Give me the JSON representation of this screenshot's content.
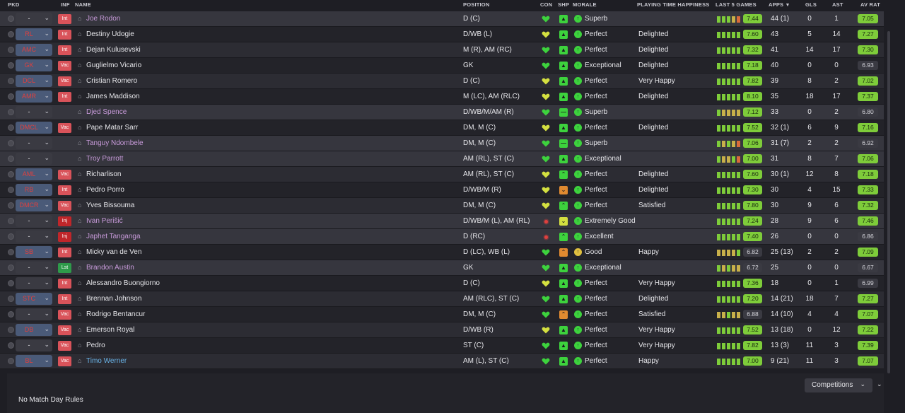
{
  "headers": {
    "pkd": "PKD",
    "inf": "INF",
    "name": "NAME",
    "position": "POSITION",
    "con": "CON",
    "shp": "SHP",
    "morale": "MORALE",
    "pth": "PLAYING TIME HAPPINESS",
    "last5": "LAST 5 GAMES",
    "apps": "APPS",
    "gls": "GLS",
    "ast": "AST",
    "avrat": "AV RAT"
  },
  "players": [
    {
      "pkd": "-",
      "sel": false,
      "inf": "Int",
      "name": "Joe Rodon",
      "name_style": "pink",
      "position": "D (C)",
      "con": "green",
      "shp": "up",
      "morale": "Superb",
      "pth": "",
      "last5": [
        "#7ecc3a",
        "#7ecc3a",
        "#7ecc3a",
        "#c8b04a",
        "#d96b3a"
      ],
      "l5": "7.44",
      "l5_green": true,
      "apps": "44 (1)",
      "gls": "0",
      "ast": "1",
      "avr": "7.05",
      "avr_green": true,
      "loan": true
    },
    {
      "pkd": "RL",
      "sel": true,
      "inf": "Int",
      "name": "Destiny Udogie",
      "name_style": "",
      "position": "D/WB (L)",
      "con": "yellow",
      "shp": "up",
      "morale": "Perfect",
      "pth": "Delighted",
      "last5": [
        "#7ecc3a",
        "#7ecc3a",
        "#7ecc3a",
        "#7ecc3a",
        "#7ecc3a"
      ],
      "l5": "7.60",
      "l5_green": true,
      "apps": "43",
      "gls": "5",
      "ast": "14",
      "avr": "7.27",
      "avr_green": true,
      "loan": false
    },
    {
      "pkd": "AMC",
      "sel": true,
      "inf": "Int",
      "name": "Dejan Kulusevski",
      "name_style": "",
      "position": "M (R), AM (RC)",
      "con": "green",
      "shp": "up",
      "morale": "Perfect",
      "pth": "Delighted",
      "last5": [
        "#7ecc3a",
        "#7ecc3a",
        "#7ecc3a",
        "#7ecc3a",
        "#7ecc3a"
      ],
      "l5": "7.32",
      "l5_green": true,
      "apps": "41",
      "gls": "14",
      "ast": "17",
      "avr": "7.30",
      "avr_green": true,
      "loan": false
    },
    {
      "pkd": "GK",
      "sel": true,
      "inf": "Vac",
      "name": "Guglielmo Vicario",
      "name_style": "",
      "position": "GK",
      "con": "green",
      "shp": "up",
      "morale": "Exceptional",
      "pth": "Delighted",
      "last5": [
        "#7ecc3a",
        "#7ecc3a",
        "#7ecc3a",
        "#7ecc3a",
        "#7ecc3a"
      ],
      "l5": "7.18",
      "l5_green": true,
      "apps": "40",
      "gls": "0",
      "ast": "0",
      "avr": "6.93",
      "avr_green": false,
      "loan": false
    },
    {
      "pkd": "DCL",
      "sel": true,
      "inf": "Vac",
      "name": "Cristian Romero",
      "name_style": "",
      "position": "D (C)",
      "con": "yellow",
      "shp": "up",
      "morale": "Perfect",
      "pth": "Very Happy",
      "last5": [
        "#7ecc3a",
        "#7ecc3a",
        "#7ecc3a",
        "#7ecc3a",
        "#7ecc3a"
      ],
      "l5": "7.82",
      "l5_green": true,
      "apps": "39",
      "gls": "8",
      "ast": "2",
      "avr": "7.02",
      "avr_green": true,
      "loan": false
    },
    {
      "pkd": "AMR",
      "sel": true,
      "inf": "Int",
      "name": "James Maddison",
      "name_style": "",
      "position": "M (LC), AM (RLC)",
      "con": "yellow",
      "shp": "up",
      "morale": "Perfect",
      "pth": "Delighted",
      "last5": [
        "#7ecc3a",
        "#7ecc3a",
        "#7ecc3a",
        "#7ecc3a",
        "#7ecc3a"
      ],
      "l5": "8.10",
      "l5_green": true,
      "apps": "35",
      "gls": "18",
      "ast": "17",
      "avr": "7.37",
      "avr_green": true,
      "loan": false
    },
    {
      "pkd": "-",
      "sel": false,
      "inf": "",
      "name": "Djed Spence",
      "name_style": "pink",
      "position": "D/WB/M/AM (R)",
      "con": "green",
      "shp": "flat",
      "morale": "Superb",
      "pth": "",
      "last5": [
        "#7ecc3a",
        "#c8b04a",
        "#c8b04a",
        "#c8b04a",
        "#c8b04a"
      ],
      "l5": "7.12",
      "l5_green": true,
      "apps": "33",
      "gls": "0",
      "ast": "2",
      "avr": "6.80",
      "avr_green": false,
      "loan": true
    },
    {
      "pkd": "DMCL",
      "sel": true,
      "inf": "Vac",
      "name": "Pape Matar Sarr",
      "name_style": "",
      "position": "DM, M (C)",
      "con": "yellow",
      "shp": "up",
      "morale": "Perfect",
      "pth": "Delighted",
      "last5": [
        "#7ecc3a",
        "#7ecc3a",
        "#7ecc3a",
        "#7ecc3a",
        "#7ecc3a"
      ],
      "l5": "7.52",
      "l5_green": true,
      "apps": "32 (1)",
      "gls": "6",
      "ast": "9",
      "avr": "7.16",
      "avr_green": true,
      "loan": false
    },
    {
      "pkd": "-",
      "sel": false,
      "inf": "",
      "name": "Tanguy Ndombele",
      "name_style": "pink",
      "position": "DM, M (C)",
      "con": "green",
      "shp": "flat",
      "morale": "Superb",
      "pth": "",
      "last5": [
        "#7ecc3a",
        "#c8b04a",
        "#7ecc3a",
        "#c8b04a",
        "#d96b3a"
      ],
      "l5": "7.06",
      "l5_green": true,
      "apps": "31 (7)",
      "gls": "2",
      "ast": "2",
      "avr": "6.92",
      "avr_green": false,
      "loan": true
    },
    {
      "pkd": "-",
      "sel": false,
      "inf": "",
      "name": "Troy Parrott",
      "name_style": "pink",
      "position": "AM (RL), ST (C)",
      "con": "green",
      "shp": "up",
      "morale": "Exceptional",
      "pth": "",
      "last5": [
        "#7ecc3a",
        "#c8b04a",
        "#c8b04a",
        "#7ecc3a",
        "#d96b3a"
      ],
      "l5": "7.00",
      "l5_green": true,
      "apps": "31",
      "gls": "8",
      "ast": "7",
      "avr": "7.06",
      "avr_green": true,
      "loan": true
    },
    {
      "pkd": "AML",
      "sel": true,
      "inf": "Vac",
      "name": "Richarlison",
      "name_style": "",
      "position": "AM (RL), ST (C)",
      "con": "yellow",
      "shp": "up2",
      "morale": "Perfect",
      "pth": "Delighted",
      "last5": [
        "#7ecc3a",
        "#7ecc3a",
        "#7ecc3a",
        "#7ecc3a",
        "#7ecc3a"
      ],
      "l5": "7.60",
      "l5_green": true,
      "apps": "30 (1)",
      "gls": "12",
      "ast": "8",
      "avr": "7.18",
      "avr_green": true,
      "loan": false
    },
    {
      "pkd": "RB",
      "sel": true,
      "inf": "Int",
      "name": "Pedro Porro",
      "name_style": "",
      "position": "D/WB/M (R)",
      "con": "yellow",
      "shp": "down",
      "morale": "Perfect",
      "pth": "Delighted",
      "last5": [
        "#7ecc3a",
        "#7ecc3a",
        "#7ecc3a",
        "#7ecc3a",
        "#7ecc3a"
      ],
      "l5": "7.30",
      "l5_green": true,
      "apps": "30",
      "gls": "4",
      "ast": "15",
      "avr": "7.33",
      "avr_green": true,
      "loan": false
    },
    {
      "pkd": "DMCR",
      "sel": true,
      "inf": "Vac",
      "name": "Yves Bissouma",
      "name_style": "",
      "position": "DM, M (C)",
      "con": "yellow",
      "shp": "up2",
      "morale": "Perfect",
      "pth": "Satisfied",
      "last5": [
        "#7ecc3a",
        "#7ecc3a",
        "#7ecc3a",
        "#7ecc3a",
        "#7ecc3a"
      ],
      "l5": "7.80",
      "l5_green": true,
      "apps": "30",
      "gls": "9",
      "ast": "6",
      "avr": "7.32",
      "avr_green": true,
      "loan": false
    },
    {
      "pkd": "-",
      "sel": false,
      "inf": "Inj",
      "name": "Ivan Perišić",
      "name_style": "pink",
      "position": "D/WB/M (L), AM (RL)",
      "con": "dot",
      "shp": "flat-y",
      "morale": "Extremely Good",
      "pth": "",
      "last5": [
        "#7ecc3a",
        "#7ecc3a",
        "#7ecc3a",
        "#7ecc3a",
        "#7ecc3a"
      ],
      "l5": "7.24",
      "l5_green": true,
      "apps": "28",
      "gls": "9",
      "ast": "6",
      "avr": "7.46",
      "avr_green": true,
      "loan": true
    },
    {
      "pkd": "-",
      "sel": false,
      "inf": "Inj",
      "name": "Japhet Tanganga",
      "name_style": "pink",
      "position": "D (RC)",
      "con": "dot",
      "shp": "up2",
      "morale": "Excellent",
      "pth": "",
      "last5": [
        "#7ecc3a",
        "#7ecc3a",
        "#7ecc3a",
        "#7ecc3a",
        "#7ecc3a"
      ],
      "l5": "7.40",
      "l5_green": true,
      "apps": "26",
      "gls": "0",
      "ast": "0",
      "avr": "6.86",
      "avr_green": false,
      "loan": true
    },
    {
      "pkd": "SB",
      "sel": true,
      "inf": "Int",
      "name": "Micky van de Ven",
      "name_style": "",
      "position": "D (LC), WB (L)",
      "con": "green",
      "shp": "down2",
      "morale": "Good",
      "pth": "Happy",
      "last5": [
        "#c8b04a",
        "#c8b04a",
        "#c8b04a",
        "#c8b04a",
        "#7ecc3a"
      ],
      "l5": "6.82",
      "l5_green": false,
      "apps": "25 (13)",
      "gls": "2",
      "ast": "2",
      "avr": "7.09",
      "avr_green": true,
      "loan": false
    },
    {
      "pkd": "-",
      "sel": false,
      "inf": "Lst",
      "name": "Brandon Austin",
      "name_style": "pink",
      "position": "GK",
      "con": "green",
      "shp": "up",
      "morale": "Exceptional",
      "pth": "",
      "last5": [
        "#7ecc3a",
        "#c8b04a",
        "#7ecc3a",
        "#c8b04a",
        "#c8b04a"
      ],
      "l5": "6.72",
      "l5_green": false,
      "apps": "25",
      "gls": "0",
      "ast": "0",
      "avr": "6.67",
      "avr_green": false,
      "loan": true
    },
    {
      "pkd": "-",
      "sel": false,
      "inf": "Int",
      "name": "Alessandro Buongiorno",
      "name_style": "",
      "position": "D (C)",
      "con": "yellow",
      "shp": "up",
      "morale": "Perfect",
      "pth": "Very Happy",
      "last5": [
        "#7ecc3a",
        "#7ecc3a",
        "#7ecc3a",
        "#7ecc3a",
        "#7ecc3a"
      ],
      "l5": "7.36",
      "l5_green": true,
      "apps": "18",
      "gls": "0",
      "ast": "1",
      "avr": "6.99",
      "avr_green": false,
      "loan": false
    },
    {
      "pkd": "STC",
      "sel": true,
      "inf": "Int",
      "name": "Brennan Johnson",
      "name_style": "",
      "position": "AM (RLC), ST (C)",
      "con": "green",
      "shp": "up",
      "morale": "Perfect",
      "pth": "Delighted",
      "last5": [
        "#7ecc3a",
        "#7ecc3a",
        "#7ecc3a",
        "#7ecc3a",
        "#7ecc3a"
      ],
      "l5": "7.20",
      "l5_green": true,
      "apps": "14 (21)",
      "gls": "18",
      "ast": "7",
      "avr": "7.27",
      "avr_green": true,
      "loan": false
    },
    {
      "pkd": "-",
      "sel": false,
      "inf": "Vac",
      "name": "Rodrigo Bentancur",
      "name_style": "",
      "position": "DM, M (C)",
      "con": "green",
      "shp": "down2",
      "morale": "Perfect",
      "pth": "Satisfied",
      "last5": [
        "#c8b04a",
        "#c8b04a",
        "#7ecc3a",
        "#c8b04a",
        "#c8b04a"
      ],
      "l5": "6.88",
      "l5_green": false,
      "apps": "14 (10)",
      "gls": "4",
      "ast": "4",
      "avr": "7.07",
      "avr_green": true,
      "loan": false
    },
    {
      "pkd": "DB",
      "sel": true,
      "inf": "Vac",
      "name": "Emerson Royal",
      "name_style": "",
      "position": "D/WB (R)",
      "con": "yellow",
      "shp": "up",
      "morale": "Perfect",
      "pth": "Very Happy",
      "last5": [
        "#7ecc3a",
        "#7ecc3a",
        "#7ecc3a",
        "#7ecc3a",
        "#7ecc3a"
      ],
      "l5": "7.52",
      "l5_green": true,
      "apps": "13 (18)",
      "gls": "0",
      "ast": "12",
      "avr": "7.22",
      "avr_green": true,
      "loan": false
    },
    {
      "pkd": "-",
      "sel": false,
      "inf": "Vac",
      "name": "Pedro",
      "name_style": "",
      "position": "ST (C)",
      "con": "green",
      "shp": "up",
      "morale": "Perfect",
      "pth": "Very Happy",
      "last5": [
        "#7ecc3a",
        "#7ecc3a",
        "#7ecc3a",
        "#7ecc3a",
        "#7ecc3a"
      ],
      "l5": "7.82",
      "l5_green": true,
      "apps": "13 (3)",
      "gls": "11",
      "ast": "3",
      "avr": "7.39",
      "avr_green": true,
      "loan": false
    },
    {
      "pkd": "BL",
      "sel": true,
      "inf": "Vac",
      "name": "Timo Werner",
      "name_style": "blue",
      "position": "AM (L), ST (C)",
      "con": "green",
      "shp": "up",
      "morale": "Perfect",
      "pth": "Happy",
      "last5": [
        "#7ecc3a",
        "#7ecc3a",
        "#7ecc3a",
        "#7ecc3a",
        "#7ecc3a"
      ],
      "l5": "7.00",
      "l5_green": true,
      "apps": "9 (21)",
      "gls": "11",
      "ast": "3",
      "avr": "7.07",
      "avr_green": true,
      "loan": false
    }
  ],
  "footer": {
    "competitions_label": "Competitions",
    "match_day_rules": "No Match Day Rules"
  }
}
